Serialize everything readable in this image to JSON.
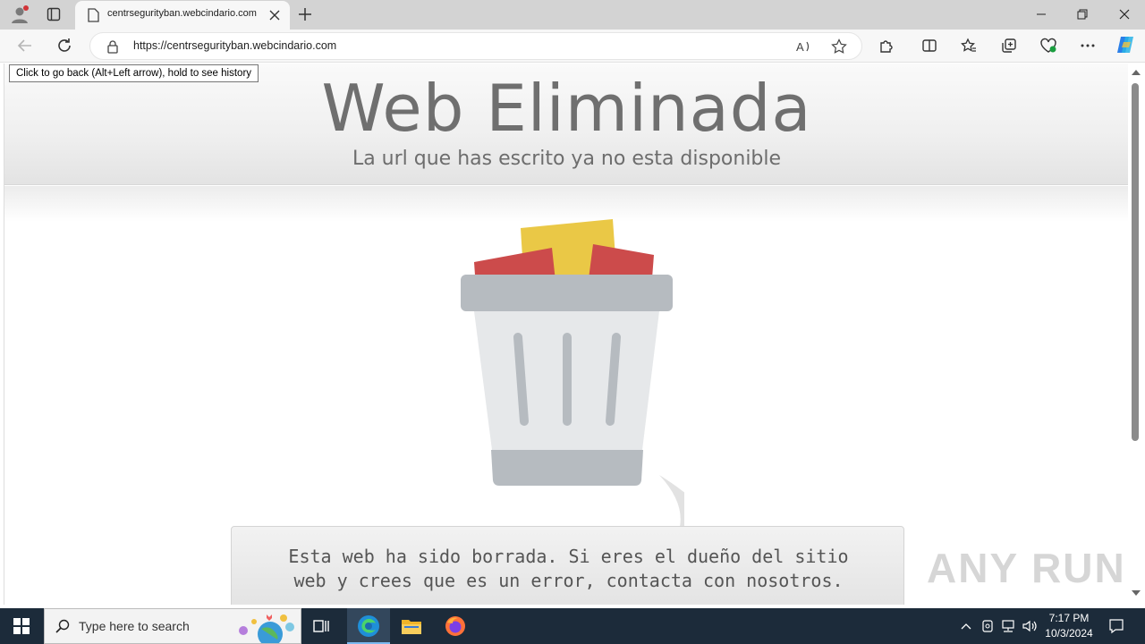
{
  "browser": {
    "tab_title": "centrsegurityban.webcindario.com",
    "url": "https://centrsegurityban.webcindario.com",
    "tooltip": "Click to go back (Alt+Left arrow), hold to see history"
  },
  "page": {
    "title": "Web Eliminada",
    "subtitle": "La url que has escrito ya no esta disponible",
    "message_line1": "Esta web ha sido borrada. Si eres el dueño del sitio",
    "message_line2": "web y crees que es un error, contacta con nosotros."
  },
  "taskbar": {
    "search_placeholder": "Type here to search",
    "time": "7:17 PM",
    "date": "10/3/2024"
  },
  "watermark": "ANY RUN",
  "colors": {
    "trash_body": "#e6e8ea",
    "trash_lid": "#b6bbc0",
    "paper_red": "#cc4b4b",
    "paper_yellow": "#eac846",
    "taskbar": "#1c2b3a"
  }
}
